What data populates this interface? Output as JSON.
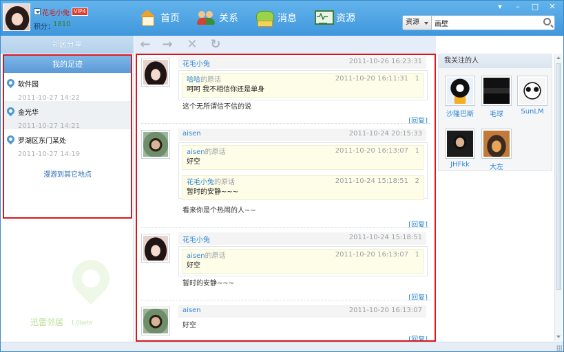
{
  "user": {
    "name": "花毛小兔",
    "vip": "VIP4",
    "score_label": "积分：",
    "score": "1810"
  },
  "nav": [
    {
      "label": "首页",
      "icon": "home-icon"
    },
    {
      "label": "关系",
      "icon": "relations-icon"
    },
    {
      "label": "消息",
      "icon": "message-icon"
    },
    {
      "label": "资源",
      "icon": "resource-icon"
    }
  ],
  "window": {
    "menu": "▾",
    "minimize": "–",
    "maximize": "□",
    "close": "✕"
  },
  "search": {
    "type": "资源",
    "value": "画壁"
  },
  "left": {
    "neighbor_share": "邻居分享",
    "footprint_title": "我的足迹",
    "places": [
      {
        "name": "软件园",
        "time": "2011-10-27 14:22"
      },
      {
        "name": "金光华",
        "time": "2011-10-27 14:21"
      },
      {
        "name": "罗湖区东门某处",
        "time": "2011-10-27 14:19"
      }
    ],
    "roam_link": "漫游到其它地点",
    "watermark": "迅雷邻居",
    "watermark_version": "1.0beta"
  },
  "toolbar": {
    "back": "←",
    "forward": "→",
    "stop": "✕",
    "refresh": "↻"
  },
  "feed": {
    "reply_label": "[回复]",
    "posts": [
      {
        "author": "花毛小兔",
        "time": "2011-10-26 16:23:31",
        "avatar": "girl",
        "quotes": [
          {
            "user": "哈哈",
            "suffix": "的原话",
            "time": "2011-10-20 16:11:31",
            "num": "1",
            "text": "呵呵 我不相信你还是单身"
          }
        ],
        "body": "这个无所谓信不信的说"
      },
      {
        "author": "aisen",
        "time": "2011-10-24 20:15:33",
        "avatar": "boy",
        "quotes": [
          {
            "user": "aisen",
            "suffix": "的原话",
            "time": "2011-10-20 16:13:07",
            "num": "1",
            "text": "好空"
          },
          {
            "user": "花毛小兔",
            "suffix": "的原话",
            "time": "2011-10-24 15:18:51",
            "num": "2",
            "text": "暂时的安静~~~"
          }
        ],
        "body": "看来你是个热闹的人~~"
      },
      {
        "author": "花毛小兔",
        "time": "2011-10-24 15:18:51",
        "avatar": "girl",
        "quotes": [
          {
            "user": "aisen",
            "suffix": "的原话",
            "time": "2011-10-20 16:13:07",
            "num": "1",
            "text": "好空"
          }
        ],
        "body": "暂时的安静~~~"
      },
      {
        "author": "aisen",
        "time": "2011-10-20 16:13:07",
        "avatar": "boy",
        "quotes": [],
        "body": "好空"
      }
    ]
  },
  "right": {
    "title": "我关注的人",
    "friends": [
      {
        "name": "沙隆巴斯"
      },
      {
        "name": "毛球"
      },
      {
        "name": "SunLM"
      },
      {
        "name": "JHFkk"
      },
      {
        "name": "大左"
      }
    ]
  }
}
